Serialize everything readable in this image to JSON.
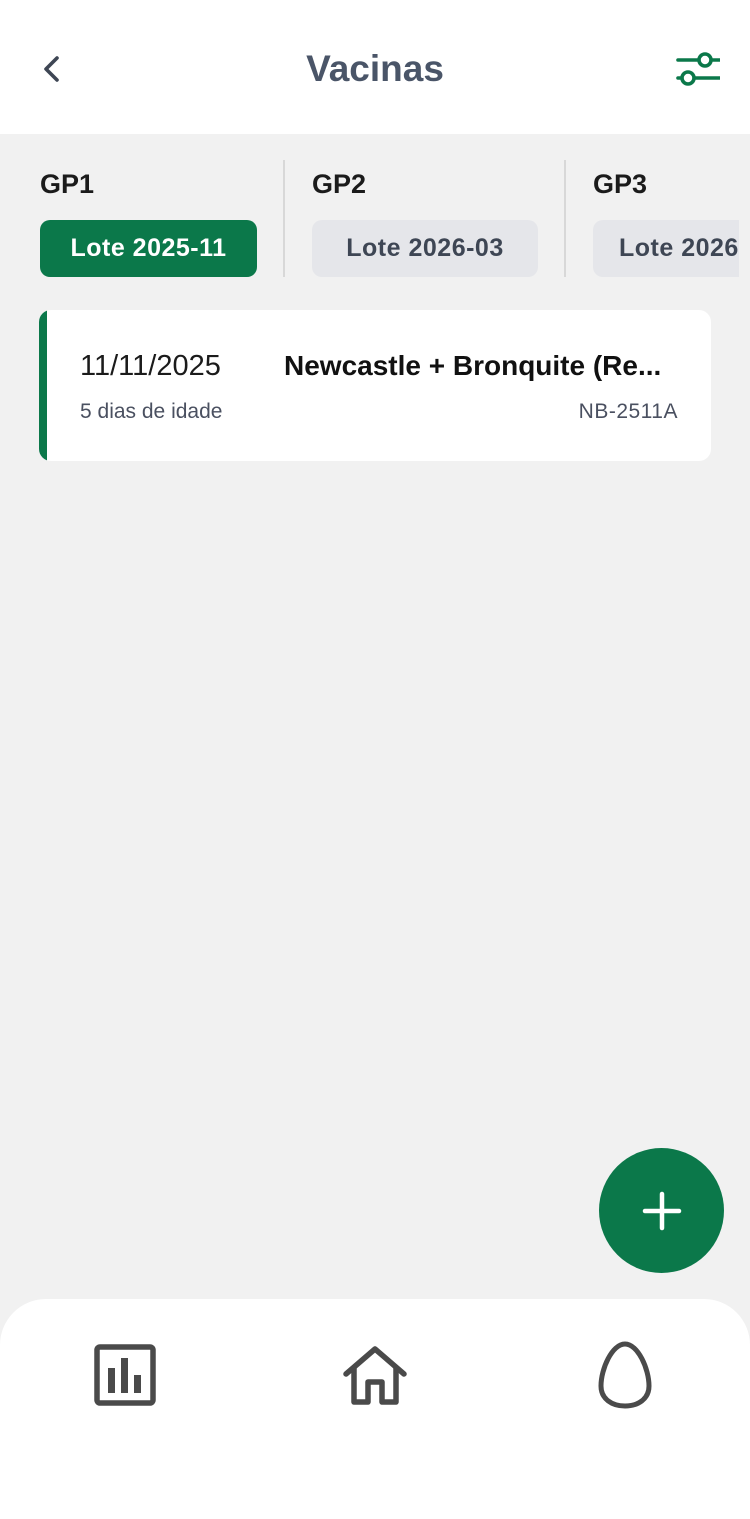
{
  "header": {
    "title": "Vacinas",
    "back_icon": "chevron-left-icon",
    "filter_icon": "sliders-icon"
  },
  "groups": [
    {
      "name": "GP1",
      "lot": "Lote 2025-11",
      "selected": true
    },
    {
      "name": "GP2",
      "lot": "Lote 2026-03",
      "selected": false
    },
    {
      "name": "GP3",
      "lot": "Lote 2026",
      "selected": false
    }
  ],
  "vaccines": [
    {
      "date": "11/11/2025",
      "name": "Newcastle + Bronquite (Re...",
      "age": "5 dias de idade",
      "code": "NB-2511A"
    }
  ],
  "fab": {
    "icon": "plus-icon"
  },
  "bottom_nav": {
    "items": [
      {
        "icon": "bar-chart-icon"
      },
      {
        "icon": "home-icon"
      },
      {
        "icon": "egg-icon"
      }
    ]
  },
  "colors": {
    "accent": "#0b784a",
    "title": "#4a5568",
    "chip_inactive": "#e5e6ea",
    "background": "#f1f1f1"
  }
}
